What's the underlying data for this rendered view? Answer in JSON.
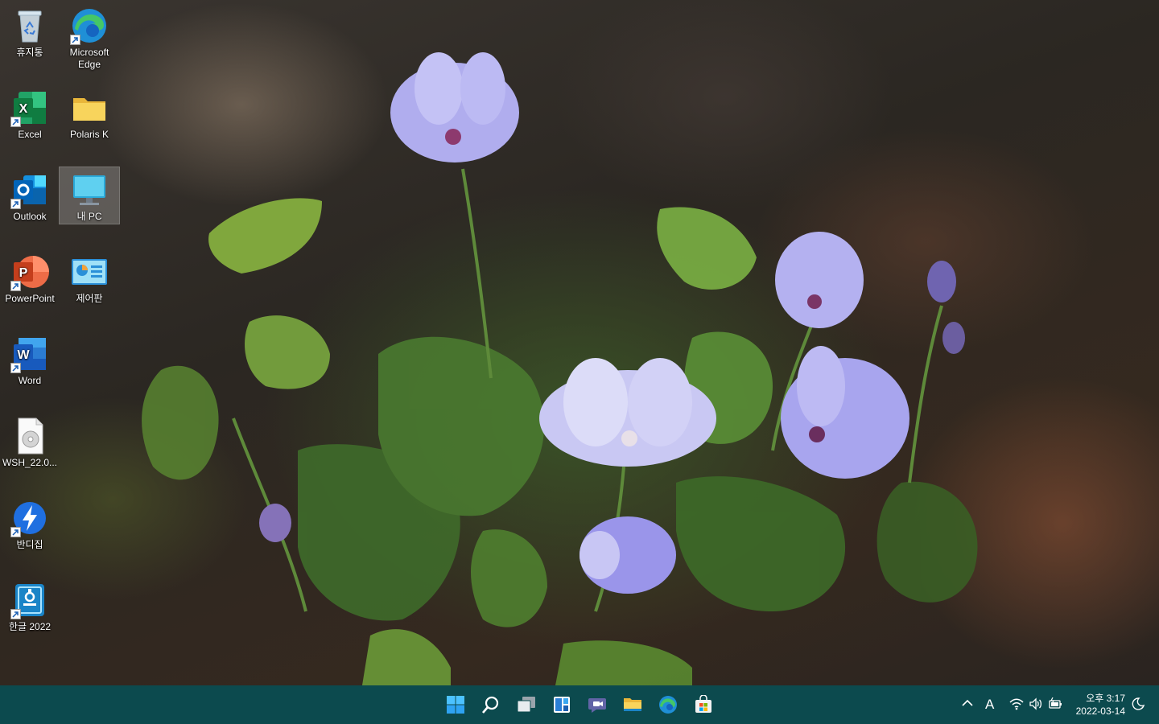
{
  "desktop": {
    "icons": [
      {
        "label": "휴지통",
        "icon": "recycle-bin-icon"
      },
      {
        "label": "Microsoft Edge",
        "icon": "edge-icon"
      },
      {
        "label": "Excel",
        "icon": "excel-icon"
      },
      {
        "label": "Polaris K",
        "icon": "folder-icon"
      },
      {
        "label": "Outlook",
        "icon": "outlook-icon"
      },
      {
        "label": "내 PC",
        "icon": "this-pc-icon"
      },
      {
        "label": "PowerPoint",
        "icon": "powerpoint-icon"
      },
      {
        "label": "제어판",
        "icon": "control-panel-icon"
      },
      {
        "label": "Word",
        "icon": "word-icon"
      },
      {
        "label": "WSH_22.0...",
        "icon": "disc-image-file-icon"
      },
      {
        "label": "반디집",
        "icon": "bandizip-icon"
      },
      {
        "label": "한글 2022",
        "icon": "hangul-icon"
      }
    ]
  },
  "taskbar": {
    "apps": [
      "start-icon",
      "search-icon",
      "task-view-icon",
      "widgets-icon",
      "teams-chat-icon",
      "file-explorer-icon",
      "edge-icon",
      "store-icon"
    ],
    "tray": {
      "ime": "A",
      "time": "오후 3:17",
      "date": "2022-03-14"
    },
    "accent": "#0c4a4e"
  }
}
